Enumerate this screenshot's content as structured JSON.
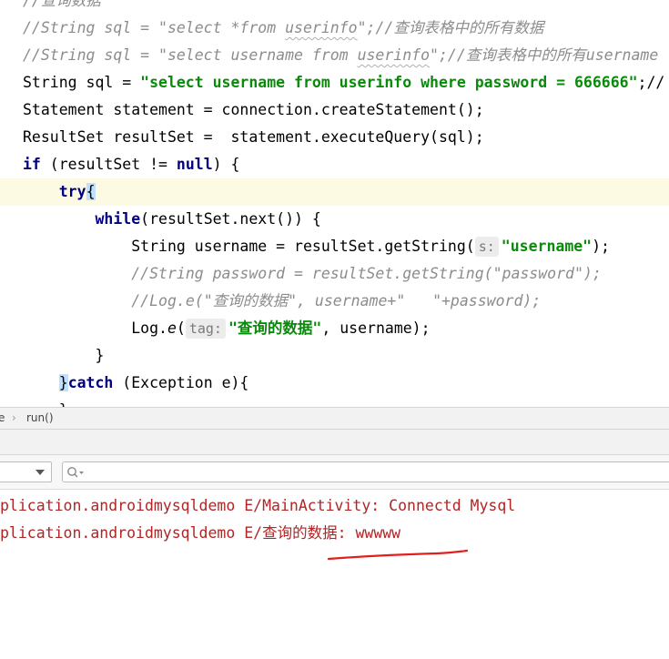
{
  "editor": {
    "lines": [
      {
        "indent": "",
        "parts": [
          {
            "t": "//查询数据",
            "c": "cmt"
          }
        ]
      },
      {
        "indent": "",
        "parts": [
          {
            "t": "//String sql = \"select *from ",
            "c": "cmt"
          },
          {
            "t": "userinfo",
            "c": "cmt squig"
          },
          {
            "t": "\";//查询表格中的所有数据",
            "c": "cmt"
          }
        ]
      },
      {
        "indent": "",
        "parts": [
          {
            "t": "//String sql = \"select username from ",
            "c": "cmt"
          },
          {
            "t": "userinfo",
            "c": "cmt squig"
          },
          {
            "t": "\";//查询表格中的所有username",
            "c": "cmt"
          }
        ]
      },
      {
        "indent": "",
        "parts": [
          {
            "t": "String sql = "
          },
          {
            "t": "\"select username from userinfo where password = 666666\"",
            "c": "str"
          },
          {
            "t": ";//"
          }
        ]
      },
      {
        "indent": "",
        "parts": [
          {
            "t": "Statement statement = connection.createStatement();"
          }
        ]
      },
      {
        "indent": "",
        "parts": [
          {
            "t": "ResultSet resultSet =  statement.executeQuery(sql);"
          }
        ]
      },
      {
        "indent": "",
        "parts": [
          {
            "t": "if",
            "c": "kw"
          },
          {
            "t": " (resultSet != "
          },
          {
            "t": "null",
            "c": "kw"
          },
          {
            "t": ") {"
          }
        ]
      },
      {
        "indent": "    ",
        "cur": true,
        "parts": [
          {
            "t": "try",
            "c": "kw"
          },
          {
            "t": "{",
            "c": "brace-hl"
          }
        ]
      },
      {
        "indent": "        ",
        "parts": [
          {
            "t": "while",
            "c": "kw"
          },
          {
            "t": "(resultSet.next()) {"
          }
        ]
      },
      {
        "indent": "            ",
        "parts": [
          {
            "t": "String username = resultSet.getString("
          },
          {
            "t": "s:",
            "c": "hint"
          },
          {
            "t": "\"username\"",
            "c": "str"
          },
          {
            "t": ");"
          }
        ]
      },
      {
        "indent": "            ",
        "parts": [
          {
            "t": "//String password = resultSet.getString(\"password\");",
            "c": "cmt"
          }
        ]
      },
      {
        "indent": "            ",
        "parts": [
          {
            "t": "//Log.e(\"查询的数据\", username+\"   \"+password);",
            "c": "cmt"
          }
        ]
      },
      {
        "indent": "            ",
        "parts": [
          {
            "t": "Log."
          },
          {
            "t": "e",
            "c": "m-i"
          },
          {
            "t": "("
          },
          {
            "t": "tag:",
            "c": "hint"
          },
          {
            "t": "\"查询的数据\"",
            "c": "str"
          },
          {
            "t": ", username);"
          }
        ]
      },
      {
        "indent": "        ",
        "parts": [
          {
            "t": "}"
          }
        ]
      },
      {
        "indent": "    ",
        "parts": [
          {
            "t": "}",
            "c": "brace-hl"
          },
          {
            "t": "catch",
            "c": "kw"
          },
          {
            "t": " (Exception e){"
          }
        ]
      },
      {
        "indent": "    ",
        "parts": [
          {
            "t": "}"
          }
        ]
      }
    ]
  },
  "breadcrumb": {
    "class_fragment": "e",
    "method": "run()"
  },
  "logcat": {
    "lines": [
      "plication.androidmysqldemo E/MainActivity: Connectd Mysql",
      "plication.androidmysqldemo E/查询的数据: wwwww"
    ]
  },
  "colors": {
    "annotation": "#e0201c",
    "log_text": "#b02525"
  }
}
